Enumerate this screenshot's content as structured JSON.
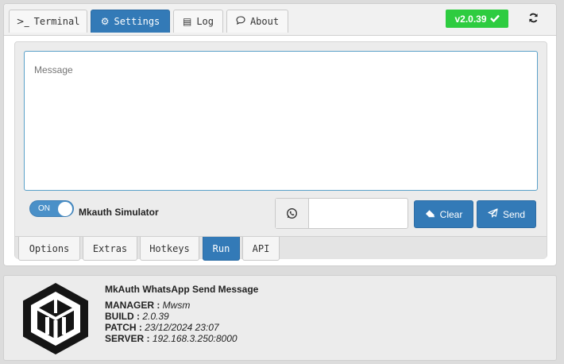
{
  "tabs": {
    "terminal": {
      "icon": ">_",
      "label": "Terminal"
    },
    "settings": {
      "icon": "⚙",
      "label": "Settings"
    },
    "log": {
      "icon": "▤",
      "label": "Log"
    },
    "about": {
      "icon": "💬",
      "label": "About"
    }
  },
  "version_badge": {
    "label": "v2.0.39",
    "icon": "check-icon",
    "color": "#2ecc40"
  },
  "refresh": {
    "icon": "refresh-icon"
  },
  "message": {
    "placeholder": "Message"
  },
  "simulator": {
    "toggle_state": "ON",
    "label": "Mkauth Simulator"
  },
  "phone": {
    "icon": "whatsapp-icon",
    "value": ""
  },
  "buttons": {
    "clear": "Clear",
    "send": "Send"
  },
  "subtabs": {
    "options": "Options",
    "extras": "Extras",
    "hotkeys": "Hotkeys",
    "run": "Run",
    "api": "API"
  },
  "about": {
    "title": "MkAuth WhatsApp Send Message",
    "manager_label": "MANAGER :",
    "manager": "Mwsm",
    "build_label": "BUILD :",
    "build": "2.0.39",
    "patch_label": "PATCH :",
    "patch": "23/12/2024 23:07",
    "server_label": "SERVER :",
    "server": "192.168.3.250:8000"
  },
  "colors": {
    "accent": "#337ab7",
    "success": "#2ecc40"
  }
}
